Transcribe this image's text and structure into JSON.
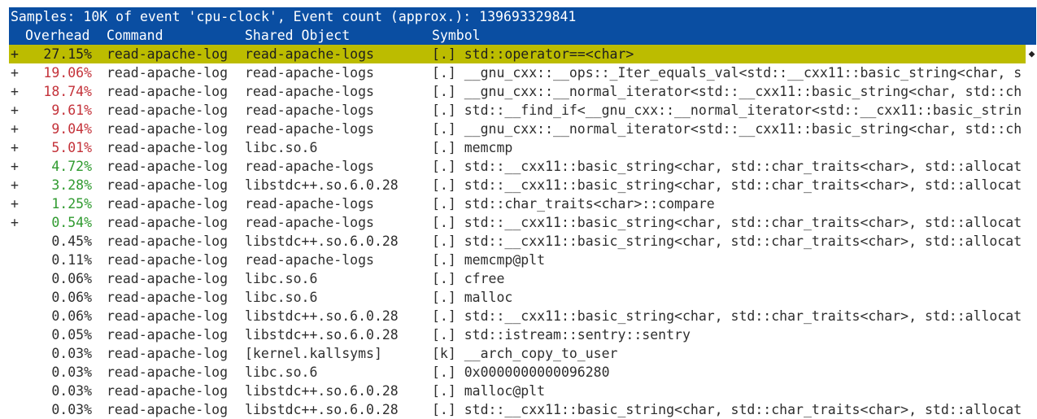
{
  "title": "Samples: 10K of event 'cpu-clock', Event count (approx.): 139693329841",
  "headers": {
    "overhead": "Overhead",
    "command": "Command",
    "shared_object": "Shared Object",
    "symbol": "Symbol"
  },
  "colors": {
    "bar_bg": "#0a4ea2",
    "selected_bg": "#bcbc00",
    "high_overhead": "#c4323a",
    "mid_overhead": "#2f9a2f"
  },
  "scroll_marker": "◆",
  "rows": [
    {
      "plus": "+",
      "overhead": "27.15%",
      "command": "read-apache-log",
      "dso": "read-apache-logs",
      "symbol": "[.] std::operator==<char>",
      "level": "red",
      "selected": true
    },
    {
      "plus": "+",
      "overhead": "19.06%",
      "command": "read-apache-log",
      "dso": "read-apache-logs",
      "symbol": "[.] __gnu_cxx::__ops::_Iter_equals_val<std::__cxx11::basic_string<char, s",
      "level": "red",
      "selected": false
    },
    {
      "plus": "+",
      "overhead": "18.74%",
      "command": "read-apache-log",
      "dso": "read-apache-logs",
      "symbol": "[.] __gnu_cxx::__normal_iterator<std::__cxx11::basic_string<char, std::ch",
      "level": "red",
      "selected": false
    },
    {
      "plus": "+",
      "overhead": "9.61%",
      "command": "read-apache-log",
      "dso": "read-apache-logs",
      "symbol": "[.] std::__find_if<__gnu_cxx::__normal_iterator<std::__cxx11::basic_strin",
      "level": "red",
      "selected": false
    },
    {
      "plus": "+",
      "overhead": "9.04%",
      "command": "read-apache-log",
      "dso": "read-apache-logs",
      "symbol": "[.] __gnu_cxx::__normal_iterator<std::__cxx11::basic_string<char, std::ch",
      "level": "red",
      "selected": false
    },
    {
      "plus": "+",
      "overhead": "5.01%",
      "command": "read-apache-log",
      "dso": "libc.so.6",
      "symbol": "[.] memcmp",
      "level": "red",
      "selected": false
    },
    {
      "plus": "+",
      "overhead": "4.72%",
      "command": "read-apache-log",
      "dso": "read-apache-logs",
      "symbol": "[.] std::__cxx11::basic_string<char, std::char_traits<char>, std::allocat",
      "level": "green",
      "selected": false
    },
    {
      "plus": "+",
      "overhead": "3.28%",
      "command": "read-apache-log",
      "dso": "libstdc++.so.6.0.28",
      "symbol": "[.] std::__cxx11::basic_string<char, std::char_traits<char>, std::allocat",
      "level": "green",
      "selected": false
    },
    {
      "plus": "+",
      "overhead": "1.25%",
      "command": "read-apache-log",
      "dso": "read-apache-logs",
      "symbol": "[.] std::char_traits<char>::compare",
      "level": "green",
      "selected": false
    },
    {
      "plus": "+",
      "overhead": "0.54%",
      "command": "read-apache-log",
      "dso": "read-apache-logs",
      "symbol": "[.] std::__cxx11::basic_string<char, std::char_traits<char>, std::allocat",
      "level": "green",
      "selected": false
    },
    {
      "plus": "",
      "overhead": "0.45%",
      "command": "read-apache-log",
      "dso": "libstdc++.so.6.0.28",
      "symbol": "[.] std::__cxx11::basic_string<char, std::char_traits<char>, std::allocat",
      "level": "plain",
      "selected": false
    },
    {
      "plus": "",
      "overhead": "0.11%",
      "command": "read-apache-log",
      "dso": "read-apache-logs",
      "symbol": "[.] memcmp@plt",
      "level": "plain",
      "selected": false
    },
    {
      "plus": "",
      "overhead": "0.06%",
      "command": "read-apache-log",
      "dso": "libc.so.6",
      "symbol": "[.] cfree",
      "level": "plain",
      "selected": false
    },
    {
      "plus": "",
      "overhead": "0.06%",
      "command": "read-apache-log",
      "dso": "libc.so.6",
      "symbol": "[.] malloc",
      "level": "plain",
      "selected": false
    },
    {
      "plus": "",
      "overhead": "0.06%",
      "command": "read-apache-log",
      "dso": "libstdc++.so.6.0.28",
      "symbol": "[.] std::__cxx11::basic_string<char, std::char_traits<char>, std::allocat",
      "level": "plain",
      "selected": false
    },
    {
      "plus": "",
      "overhead": "0.05%",
      "command": "read-apache-log",
      "dso": "libstdc++.so.6.0.28",
      "symbol": "[.] std::istream::sentry::sentry",
      "level": "plain",
      "selected": false
    },
    {
      "plus": "",
      "overhead": "0.03%",
      "command": "read-apache-log",
      "dso": "[kernel.kallsyms]",
      "symbol": "[k] __arch_copy_to_user",
      "level": "plain",
      "selected": false
    },
    {
      "plus": "",
      "overhead": "0.03%",
      "command": "read-apache-log",
      "dso": "libc.so.6",
      "symbol": "[.] 0x0000000000096280",
      "level": "plain",
      "selected": false
    },
    {
      "plus": "",
      "overhead": "0.03%",
      "command": "read-apache-log",
      "dso": "libstdc++.so.6.0.28",
      "symbol": "[.] malloc@plt",
      "level": "plain",
      "selected": false
    },
    {
      "plus": "",
      "overhead": "0.03%",
      "command": "read-apache-log",
      "dso": "libstdc++.so.6.0.28",
      "symbol": "[.] std::__cxx11::basic_string<char, std::char_traits<char>, std::allocat",
      "level": "plain",
      "selected": false
    }
  ]
}
